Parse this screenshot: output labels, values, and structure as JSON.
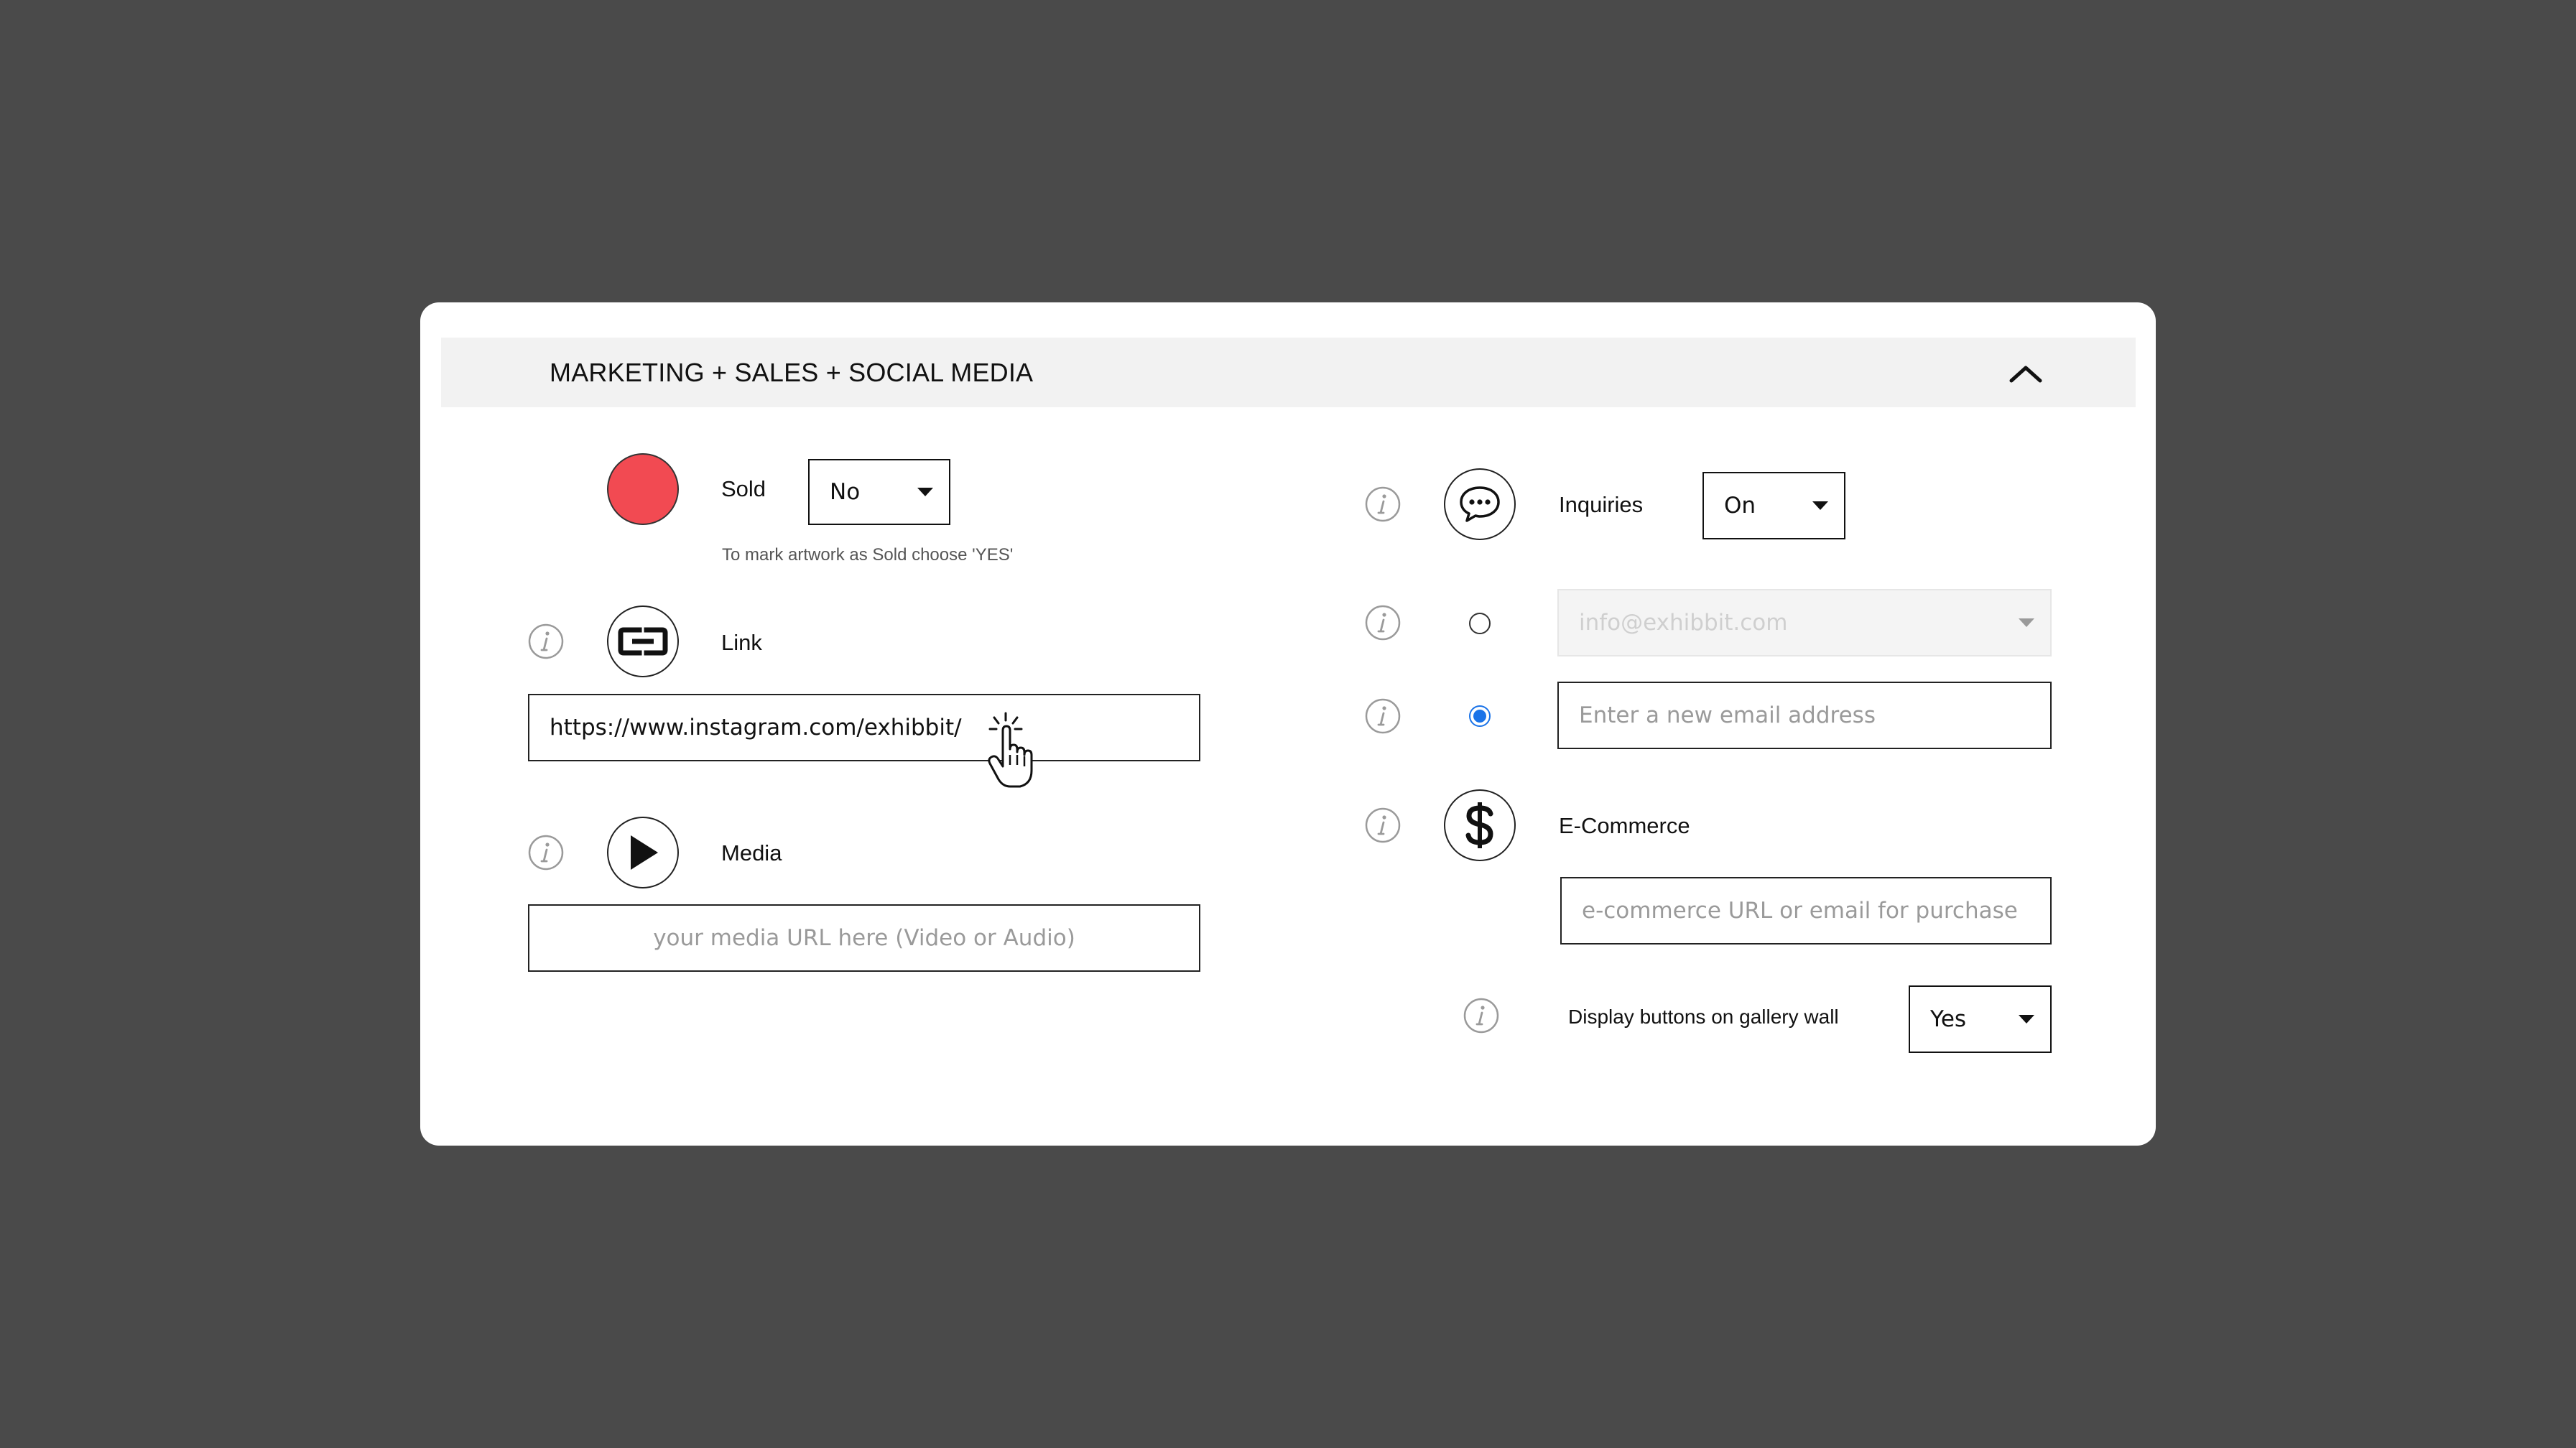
{
  "section": {
    "title": "MARKETING + SALES + SOCIAL MEDIA",
    "collapse_icon": "chevron-up-icon"
  },
  "sold": {
    "label": "Sold",
    "value": "No",
    "hint": "To mark artwork as Sold choose 'YES'",
    "indicator_color": "#f24a52"
  },
  "link": {
    "label": "Link",
    "icon": "link-icon",
    "value": "https://www.instagram.com/exhibbit/"
  },
  "media": {
    "label": "Media",
    "icon": "play-icon",
    "placeholder": "your media URL here (Video or Audio)"
  },
  "inquiries": {
    "label": "Inquiries",
    "icon": "chat-bubble-icon",
    "value": "On",
    "existing_email": "info@exhibbit.com",
    "new_email_placeholder": "Enter a new email address",
    "selected_option": "new-email"
  },
  "ecommerce": {
    "label": "E-Commerce",
    "icon": "dollar-icon",
    "placeholder": "e-commerce URL or email for purchase"
  },
  "display_buttons": {
    "label": "Display buttons on gallery wall",
    "value": "Yes"
  },
  "colors": {
    "background": "#4a4a4a",
    "header_bg": "#f2f2f2",
    "radio_accent": "#1a73e8"
  }
}
